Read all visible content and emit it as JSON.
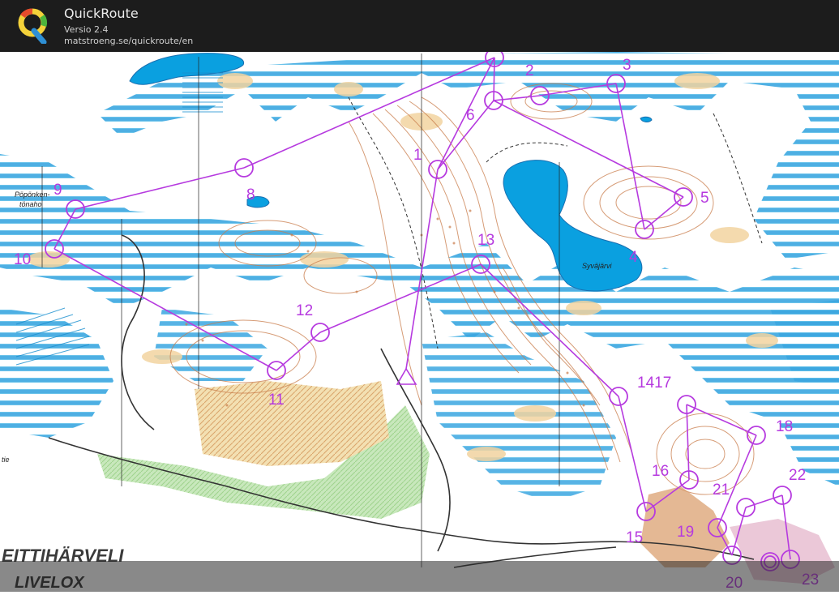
{
  "app": {
    "title": "QuickRoute",
    "version": "Versio 2.4",
    "url": "matstroeng.se/quickroute/en"
  },
  "map": {
    "labels": {
      "popponen": "Pöpönken-",
      "popponen2": "tönaho",
      "lake": "Syväjärvi",
      "tittiharveli": "EITTIHÄRVELI",
      "livelox": "LIVELOX",
      "tie": "tie"
    }
  },
  "course": {
    "color": "#b63adf",
    "controls": [
      "1",
      "2",
      "3",
      "4",
      "5",
      "6",
      "8",
      "9",
      "10",
      "11",
      "12",
      "13",
      "1417",
      "15",
      "16",
      "18",
      "19",
      "20",
      "21",
      "22",
      "23"
    ]
  },
  "colors": {
    "water": "#1e9fdc",
    "open": "#f2d7a4",
    "vegetation": "#bfe3b5",
    "contour": "#c4784a",
    "course": "#b63adf"
  }
}
